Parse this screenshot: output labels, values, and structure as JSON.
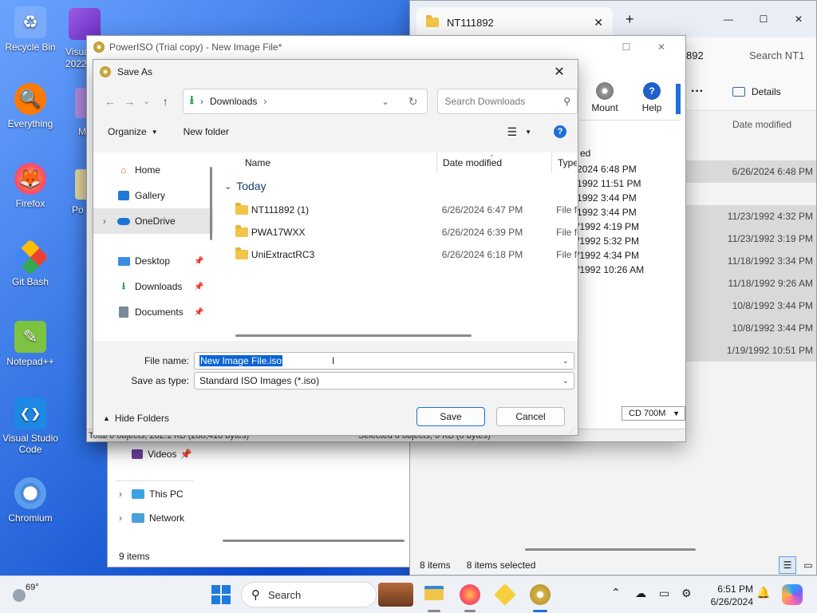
{
  "desktop": {
    "icons": [
      {
        "label": "Recycle Bin",
        "glyph": "♻"
      },
      {
        "label": "Everything",
        "glyph": "🔍"
      },
      {
        "label": "Firefox",
        "glyph": "🦊"
      },
      {
        "label": "Git Bash",
        "glyph": "◆"
      },
      {
        "label": "Notepad++",
        "glyph": "✎"
      },
      {
        "label": "Visual Studio Code",
        "glyph": "❮❯"
      },
      {
        "label": "Chromium",
        "glyph": "◎"
      }
    ],
    "partial_labels": [
      "Visua 2022",
      "M",
      "Po"
    ]
  },
  "explorer": {
    "tab_title": "NT111892",
    "address_tail": "892",
    "search": "Search NT1",
    "details": "Details",
    "more": "···",
    "col_date": "Date modified",
    "dates": [
      "6/26/2024 6:48 PM",
      "11/23/1992 4:32 PM",
      "11/23/1992 3:19 PM",
      "11/18/1992 3:34 PM",
      "11/18/1992 9:26 AM",
      "10/8/1992 3:44 PM",
      "10/8/1992 3:44 PM",
      "1/19/1992 10:51 PM"
    ],
    "status_items": "8 items",
    "status_selected": "8 items selected",
    "nav_videos": "Videos",
    "nav_thispc": "This PC",
    "nav_network": "Network",
    "status_left": "9 items"
  },
  "poweriso": {
    "title": "PowerISO (Trial copy) - New Image File*",
    "mount": "Mount",
    "help": "Help",
    "col_partial": "ed",
    "dates_partial": [
      "2024 6:48 PM",
      "1992 11:51 PM",
      "1992 3:44 PM",
      "1992 3:44 PM",
      "/1992 4:19 PM",
      "/1992 5:32 PM",
      "/1992 4:34 PM",
      "/1992 10:26 AM"
    ],
    "status_left": "Total 0 objects, 282.1 KB (288,418 bytes)",
    "status_right": "Selected 0 objects, 0 KB (0 bytes)",
    "cd_size": "CD 700M"
  },
  "dialog": {
    "title": "Save As",
    "breadcrumb": "Downloads",
    "search_placeholder": "Search Downloads",
    "organize": "Organize",
    "new_folder": "New folder",
    "nav": [
      "Home",
      "Gallery",
      "OneDrive",
      "Desktop",
      "Downloads",
      "Documents"
    ],
    "columns": {
      "name": "Name",
      "date": "Date modified",
      "type": "Type"
    },
    "group": "Today",
    "files": [
      {
        "name": "NT111892 (1)",
        "date": "6/26/2024 6:47 PM",
        "type": "File fo"
      },
      {
        "name": "PWA17WXX",
        "date": "6/26/2024 6:39 PM",
        "type": "File fo"
      },
      {
        "name": "UniExtractRC3",
        "date": "6/26/2024 6:18 PM",
        "type": "File fo"
      }
    ],
    "file_name_label": "File name:",
    "file_name_value": "New Image File.iso",
    "save_type_label": "Save as type:",
    "save_type_value": "Standard ISO Images (*.iso)",
    "hide_folders": "Hide Folders",
    "save": "Save",
    "cancel": "Cancel"
  },
  "taskbar": {
    "weather": "69°",
    "search": "Search",
    "time": "6:51 PM",
    "date": "6/26/2024"
  }
}
